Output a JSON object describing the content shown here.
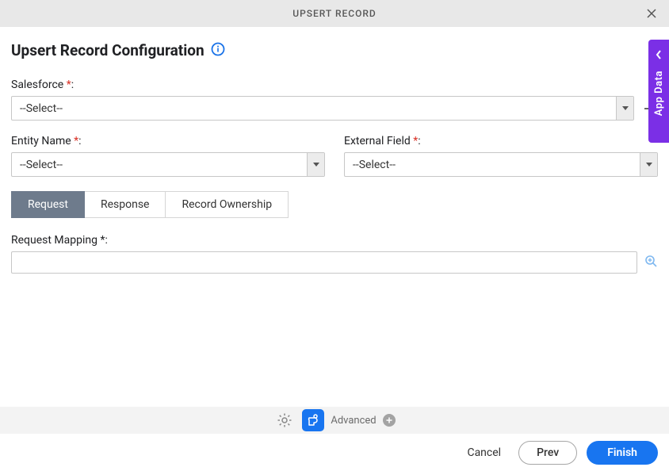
{
  "header": {
    "title": "UPSERT RECORD"
  },
  "page": {
    "title": "Upsert Record Configuration"
  },
  "fields": {
    "salesforce": {
      "label": "Salesforce",
      "value": "--Select--"
    },
    "entityName": {
      "label": "Entity Name",
      "value": "--Select--"
    },
    "externalField": {
      "label": "External Field",
      "value": "--Select--"
    },
    "requestMapping": {
      "label": "Request Mapping",
      "value": ""
    }
  },
  "tabs": {
    "request": "Request",
    "response": "Response",
    "recordOwnership": "Record Ownership"
  },
  "toolbar": {
    "advanced": "Advanced"
  },
  "footer": {
    "cancel": "Cancel",
    "prev": "Prev",
    "finish": "Finish"
  },
  "sideTab": {
    "label": "App Data"
  }
}
